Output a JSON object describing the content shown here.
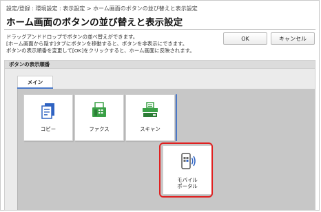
{
  "breadcrumb": "設定/登録 : 環境設定 : 表示設定 > ホーム画面のボタンの並び替えと表示設定",
  "page_title": "ホーム画面のボタンの並び替えと表示設定",
  "description": {
    "line1": "ドラッグアンドドロップでボタンの並べ替えができます。",
    "line2": "[ホーム画面から隠す]タブにボタンを移動すると、ボタンを非表示にできます。",
    "line3": "ボタンの表示順番を変更して[OK]をクリックすると、ホーム画面に反映されます。"
  },
  "buttons": {
    "ok": "OK",
    "cancel": "キャンセル"
  },
  "section": {
    "title": "ボタンの表示順番",
    "tab": "メイン"
  },
  "tiles": [
    {
      "label": "コピー",
      "icon": "copy-icon"
    },
    {
      "label": "ファクス",
      "icon": "fax-icon"
    },
    {
      "label": "スキャン",
      "icon": "scan-icon"
    },
    {
      "label_line1": "モバイル",
      "label_line2": "ポータル",
      "icon": "mobile-portal-icon"
    }
  ],
  "colors": {
    "accent": "#4a78c8",
    "highlight": "#e02020",
    "icon_green": "#3aa046",
    "icon_blue": "#2f63c2"
  }
}
